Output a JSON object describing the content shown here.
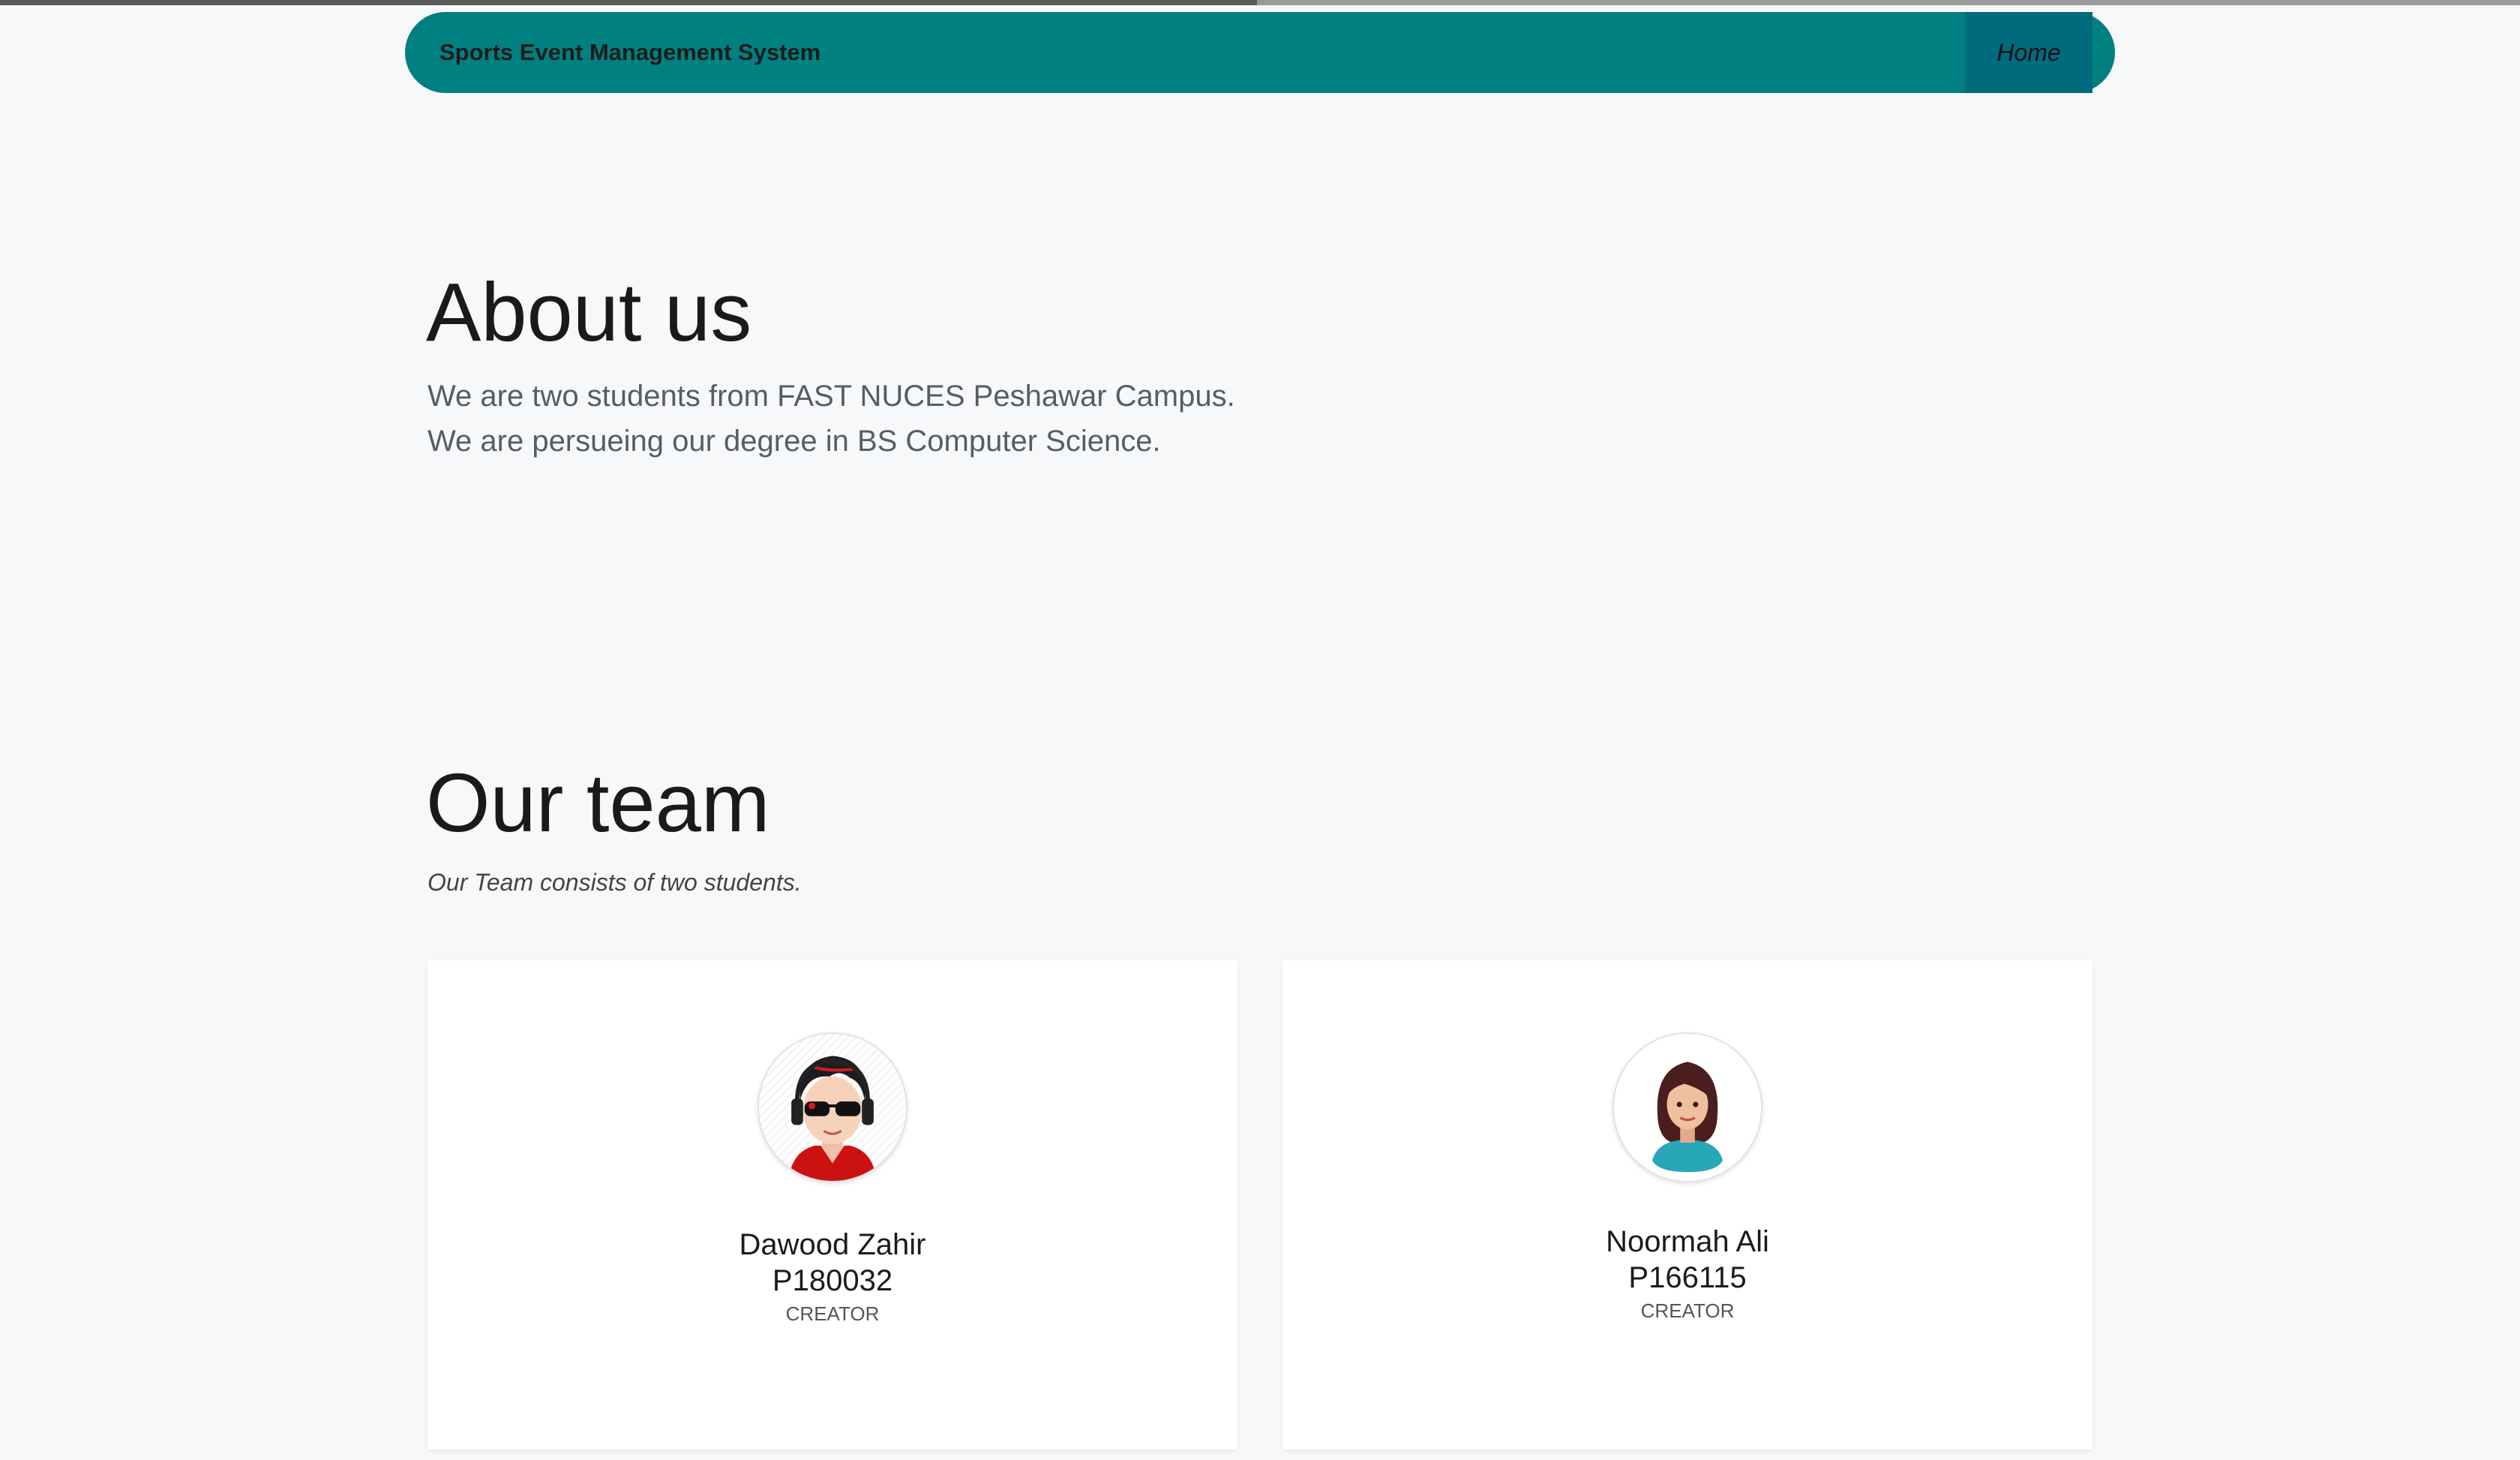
{
  "navbar": {
    "brand": "Sports Event Management System",
    "links": [
      {
        "label": "Home",
        "active": true
      }
    ],
    "color": "#008080"
  },
  "about": {
    "title": "About us",
    "lines": [
      "We are two students from FAST NUCES Peshawar Campus.",
      "We are persueing our degree in BS Computer Science."
    ]
  },
  "team": {
    "title": "Our team",
    "subtitle": "Our Team consists of two students.",
    "members": [
      {
        "name": "Dawood Zahir",
        "id": "P180032",
        "role": "CREATOR",
        "avatar": "male-avatar-headphones-sunglasses"
      },
      {
        "name": "Noormah Ali",
        "id": "P166115",
        "role": "CREATOR",
        "avatar": "female-avatar"
      }
    ]
  }
}
